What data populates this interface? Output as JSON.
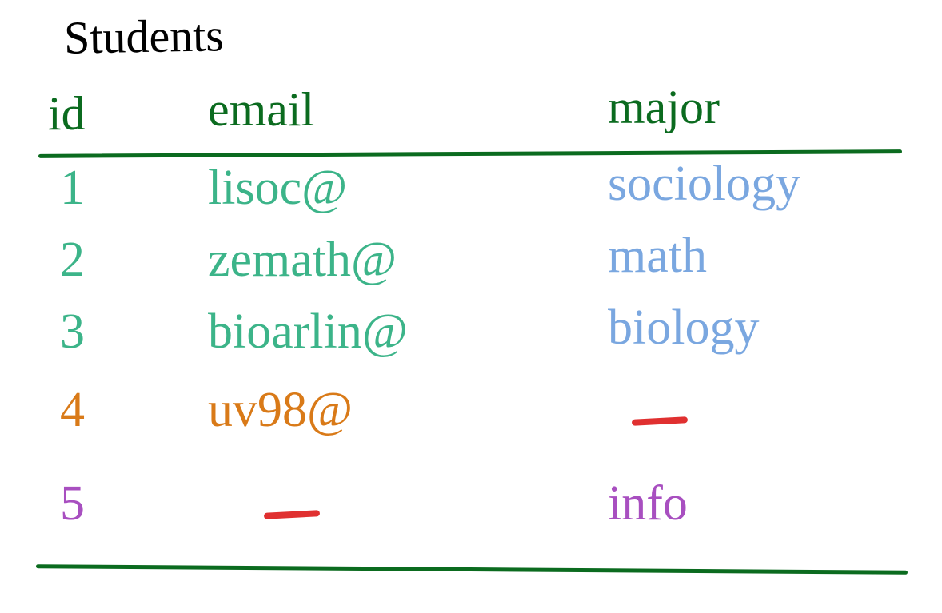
{
  "title": "Students",
  "columns": {
    "id": "id",
    "email": "email",
    "major": "major"
  },
  "rows": [
    {
      "id": "1",
      "email": "lisoc@",
      "major": "sociology"
    },
    {
      "id": "2",
      "email": "zemath@",
      "major": "math"
    },
    {
      "id": "3",
      "email": "bioarlin@",
      "major": "biology"
    },
    {
      "id": "4",
      "email": "uv98@",
      "major": "—"
    },
    {
      "id": "5",
      "email": "—",
      "major": "info"
    }
  ],
  "chart_data": {
    "type": "table",
    "title": "Students",
    "columns": [
      "id",
      "email",
      "major"
    ],
    "rows": [
      [
        1,
        "lisoc@",
        "sociology"
      ],
      [
        2,
        "zemath@",
        "math"
      ],
      [
        3,
        "bioarlin@",
        "biology"
      ],
      [
        4,
        "uv98@",
        null
      ],
      [
        5,
        null,
        "info"
      ]
    ]
  }
}
